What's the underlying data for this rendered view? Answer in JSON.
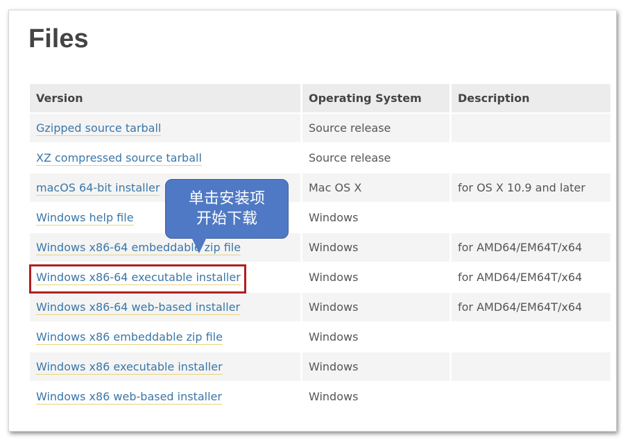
{
  "page": {
    "title": "Files"
  },
  "table": {
    "headers": [
      "Version",
      "Operating System",
      "Description"
    ],
    "rows": [
      {
        "version": "Gzipped source tarball",
        "os": "Source release",
        "description": ""
      },
      {
        "version": "XZ compressed source tarball",
        "os": "Source release",
        "description": ""
      },
      {
        "version": "macOS 64-bit installer",
        "os": "Mac OS X",
        "description": "for OS X 10.9 and later"
      },
      {
        "version": "Windows help file",
        "os": "Windows",
        "description": ""
      },
      {
        "version": "Windows x86-64 embeddable zip file",
        "os": "Windows",
        "description": "for AMD64/EM64T/x64"
      },
      {
        "version": "Windows x86-64 executable installer",
        "os": "Windows",
        "description": "for AMD64/EM64T/x64"
      },
      {
        "version": "Windows x86-64 web-based installer",
        "os": "Windows",
        "description": "for AMD64/EM64T/x64"
      },
      {
        "version": "Windows x86 embeddable zip file",
        "os": "Windows",
        "description": ""
      },
      {
        "version": "Windows x86 executable installer",
        "os": "Windows",
        "description": ""
      },
      {
        "version": "Windows x86 web-based installer",
        "os": "Windows",
        "description": ""
      }
    ]
  },
  "annotation": {
    "line1": "单击安装项",
    "line2": "开始下载",
    "callout_color": "#4f79c4",
    "highlight_color": "#b01e1e"
  }
}
